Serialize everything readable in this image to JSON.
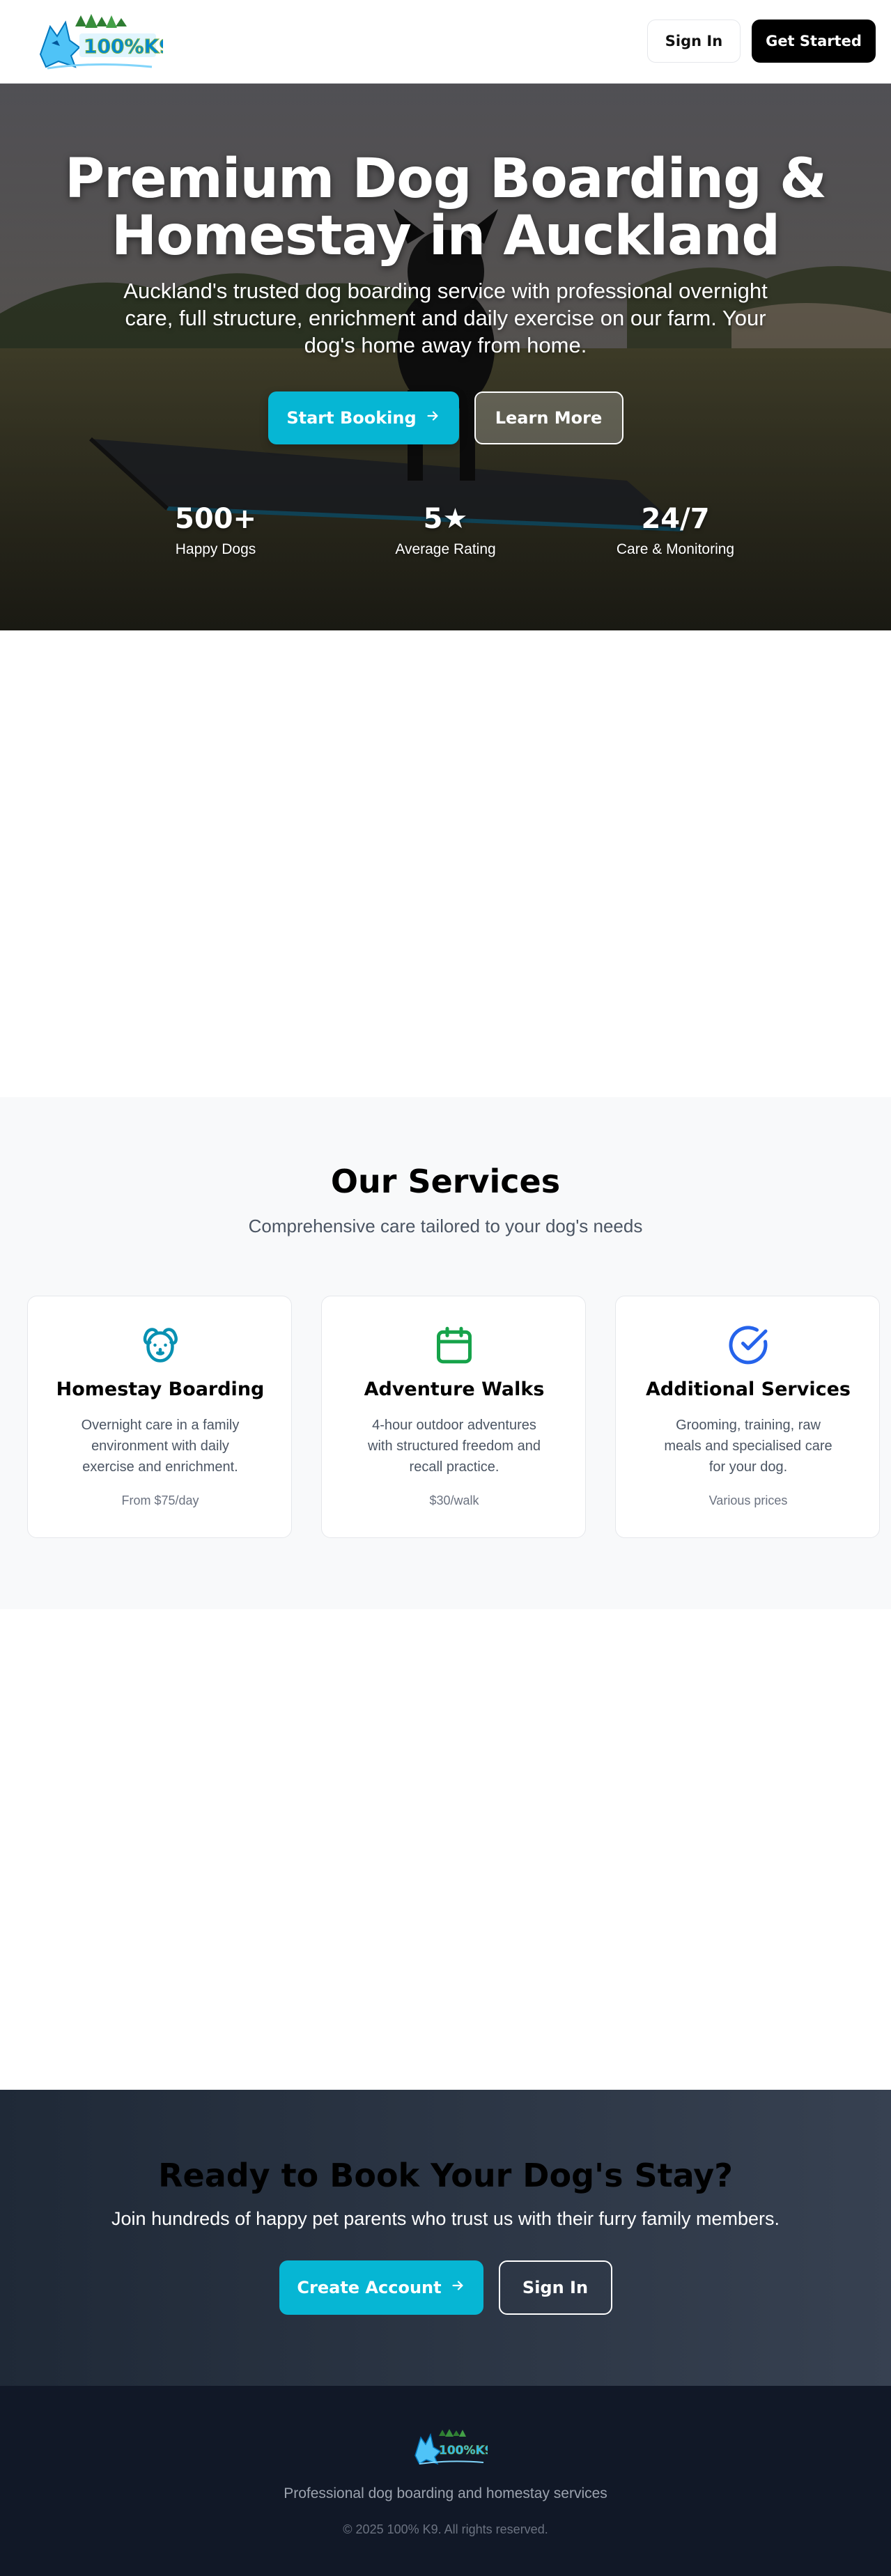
{
  "colors": {
    "accent": "#06b6d4",
    "dark": "#000000",
    "footer_bg": "#111827",
    "cta_bg_start": "#1f2937",
    "cta_bg_end": "#374151",
    "services_bg": "#f8f9fa"
  },
  "header": {
    "logo_icon": "brand-logo-icon",
    "sign_in_label": "Sign In",
    "get_started_label": "Get Started"
  },
  "hero": {
    "title": "Premium Dog Boarding & Homestay in Auckland",
    "subtitle": "Auckland's trusted dog boarding service with professional overnight care, full structure, enrichment and daily exercise on our farm. Your dog's home away from home.",
    "primary_button_label": "Start Booking",
    "primary_button_icon": "arrow-right-icon",
    "secondary_button_label": "Learn More",
    "stats": [
      {
        "value": "500+",
        "label": "Happy Dogs"
      },
      {
        "value": "5★",
        "label": "Average Rating"
      },
      {
        "value": "24/7",
        "label": "Care & Monitoring"
      }
    ]
  },
  "services": {
    "title": "Our Services",
    "subtitle": "Comprehensive care tailored to your dog's needs",
    "cards": [
      {
        "icon": "dog-face-icon",
        "icon_color": "#0891b2",
        "title": "Homestay Boarding",
        "description": "Overnight care in a family environment with daily exercise and enrichment.",
        "price": "From $75/day"
      },
      {
        "icon": "calendar-icon",
        "icon_color": "#16a34a",
        "title": "Adventure Walks",
        "description": "4-hour outdoor adventures with structured freedom and recall practice.",
        "price": "$30/walk"
      },
      {
        "icon": "check-circle-icon",
        "icon_color": "#2563eb",
        "title": "Additional Services",
        "description": "Grooming, training, raw meals and specialised care for your dog.",
        "price": "Various prices"
      }
    ]
  },
  "cta": {
    "title": "Ready to Book Your Dog's Stay?",
    "subtitle": "Join hundreds of happy pet parents who trust us with their furry family members.",
    "primary_button_label": "Create Account",
    "primary_button_icon": "arrow-right-icon",
    "secondary_button_label": "Sign In"
  },
  "footer": {
    "logo_icon": "brand-logo-icon",
    "tagline": "Professional dog boarding and homestay services",
    "copyright": "© 2025 100% K9. All rights reserved."
  }
}
